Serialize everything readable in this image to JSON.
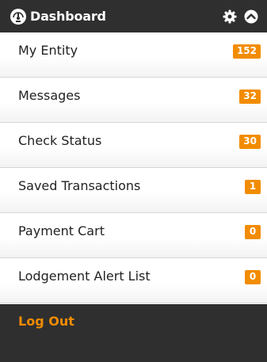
{
  "header": {
    "title": "Dashboard",
    "dashboard_icon": "gauge-icon",
    "settings_icon": "gear-icon",
    "collapse_icon": "chevron-up-circle-icon"
  },
  "menu": {
    "items": [
      {
        "label": "My Entity",
        "badge": "152"
      },
      {
        "label": "Messages",
        "badge": "32"
      },
      {
        "label": "Check Status",
        "badge": "30"
      },
      {
        "label": "Saved Transactions",
        "badge": "1"
      },
      {
        "label": "Payment Cart",
        "badge": "0"
      },
      {
        "label": "Lodgement Alert List",
        "badge": "0"
      }
    ]
  },
  "footer": {
    "logout_label": "Log Out"
  },
  "colors": {
    "header_bg": "#2f2f2f",
    "accent": "#f28c00",
    "text": "#222222"
  }
}
